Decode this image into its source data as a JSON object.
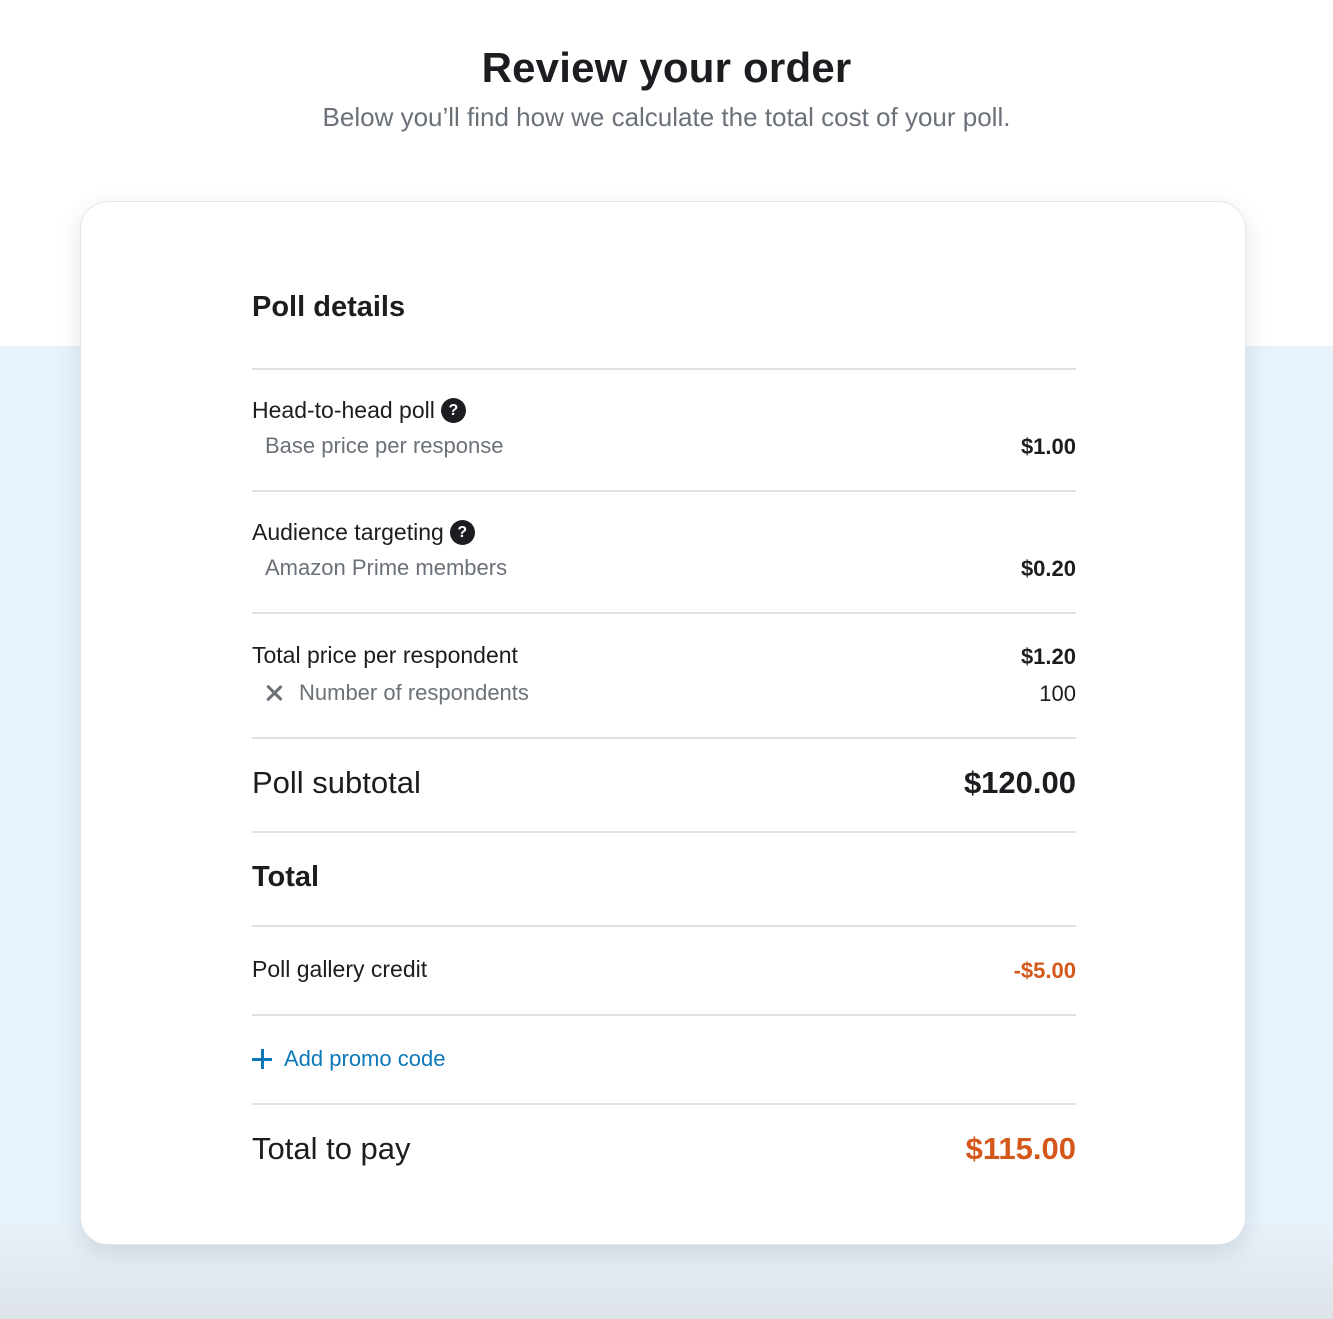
{
  "header": {
    "title": "Review your order",
    "subtitle": "Below you’ll find how we calculate the total cost of your poll."
  },
  "poll_details": {
    "section_title": "Poll details",
    "items": [
      {
        "label": "Head-to-head poll",
        "sublabel": "Base price per response",
        "value": "$1.00",
        "icon": "help-icon"
      },
      {
        "label": "Audience targeting",
        "sublabel": "Amazon Prime members",
        "value": "$0.20",
        "icon": "help-icon"
      }
    ],
    "per_respondent": {
      "label": "Total price per respondent",
      "value": "$1.20",
      "sublabel": "Number of respondents",
      "sub_icon": "times-icon",
      "sub_value": "100"
    },
    "subtotal": {
      "label": "Poll subtotal",
      "value": "$120.00"
    }
  },
  "total": {
    "section_title": "Total",
    "credit": {
      "label": "Poll gallery credit",
      "value": "-$5.00"
    },
    "promo": {
      "label": "Add promo code",
      "icon": "plus-icon"
    },
    "total_to_pay": {
      "label": "Total to pay",
      "value": "$115.00"
    }
  },
  "colors": {
    "accent": "#d4581a",
    "link": "#0e78b8",
    "background_band": "#e8f2fa",
    "text": "#1c1d20",
    "muted": "#6b7178"
  }
}
